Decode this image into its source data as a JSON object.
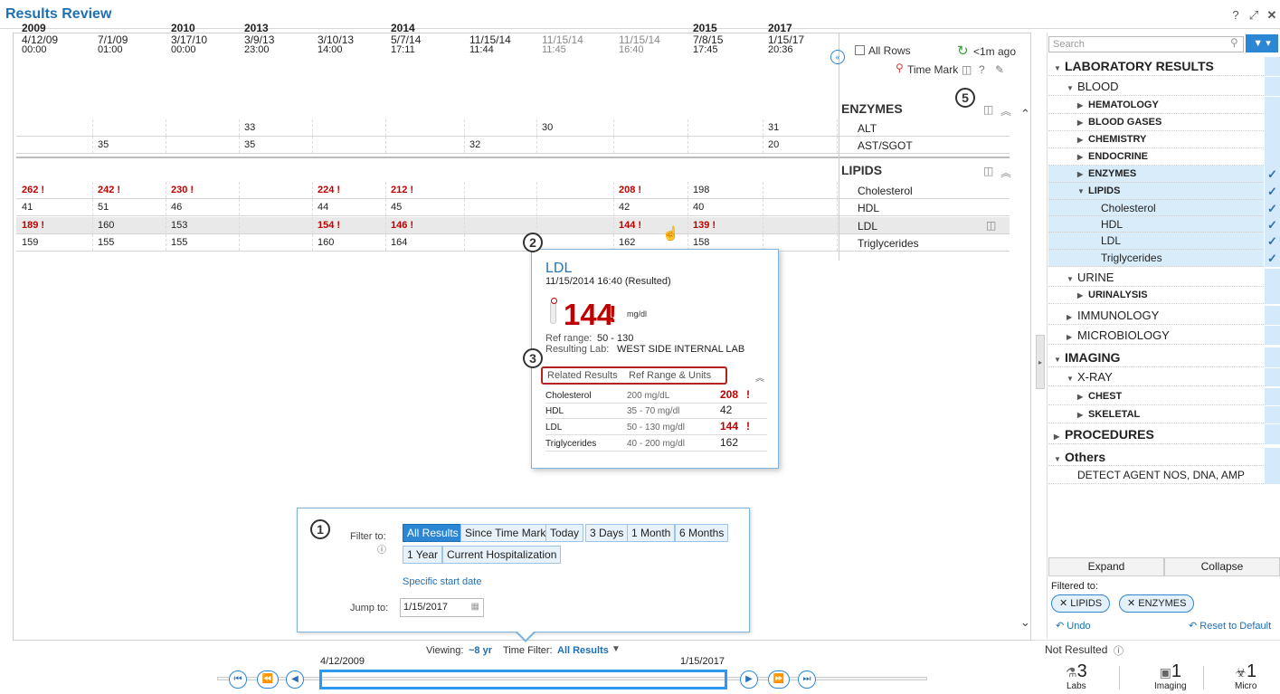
{
  "window": {
    "title": "Results Review"
  },
  "grid": {
    "columns": [
      {
        "year": "2009",
        "date": "4/12/09",
        "time": "00:00",
        "grey": false
      },
      {
        "year": "",
        "date": "7/1/09",
        "time": "01:00",
        "grey": false
      },
      {
        "year": "2010",
        "date": "3/17/10",
        "time": "00:00",
        "grey": false
      },
      {
        "year": "2013",
        "date": "3/9/13",
        "time": "23:00",
        "grey": false
      },
      {
        "year": "",
        "date": "3/10/13",
        "time": "14:00",
        "grey": false
      },
      {
        "year": "2014",
        "date": "5/7/14",
        "time": "17:11",
        "grey": false
      },
      {
        "year": "",
        "date": "11/15/14",
        "time": "11:44",
        "grey": false
      },
      {
        "year": "",
        "date": "11/15/14",
        "time": "11:45",
        "grey": true
      },
      {
        "year": "",
        "date": "11/15/14",
        "time": "16:40",
        "grey": true
      },
      {
        "year": "2015",
        "date": "7/8/15",
        "time": "17:45",
        "grey": false
      },
      {
        "year": "2017",
        "date": "1/15/17",
        "time": "20:36",
        "grey": false
      }
    ],
    "header_controls": {
      "all_rows": "All Rows",
      "refresh": "<1m ago",
      "time_mark": "Time Mark"
    },
    "sections": [
      {
        "name": "ENZYMES",
        "rows": [
          {
            "label": "ALT",
            "values": [
              "",
              "",
              "",
              "33",
              "",
              "",
              "",
              "30",
              "",
              "",
              "31"
            ],
            "abn": []
          },
          {
            "label": "AST/SGOT",
            "values": [
              "",
              "35",
              "",
              "35",
              "",
              "",
              "32",
              "",
              "",
              "",
              "20"
            ],
            "abn": []
          }
        ]
      },
      {
        "name": "LIPIDS",
        "rows": [
          {
            "label": "Cholesterol",
            "values": [
              "262",
              "242",
              "230",
              "",
              "224",
              "212",
              "",
              "",
              "208",
              "198",
              ""
            ],
            "abn": [
              0,
              1,
              2,
              4,
              5,
              8
            ]
          },
          {
            "label": "HDL",
            "values": [
              "41",
              "51",
              "46",
              "",
              "44",
              "45",
              "",
              "",
              "42",
              "40",
              ""
            ],
            "abn": []
          },
          {
            "label": "LDL",
            "values": [
              "189",
              "160",
              "153",
              "",
              "154",
              "146",
              "",
              "",
              "144",
              "139",
              ""
            ],
            "abn": [
              0,
              4,
              5,
              8,
              9
            ]
          },
          {
            "label": "Triglycerides",
            "values": [
              "159",
              "155",
              "155",
              "",
              "160",
              "164",
              "",
              "",
              "162",
              "158",
              ""
            ],
            "abn": []
          }
        ]
      }
    ]
  },
  "popup": {
    "title": "LDL",
    "subtitle": "11/15/2014 16:40 (Resulted)",
    "value": "144",
    "unit": "mg/dl",
    "ref_range_label": "Ref range:",
    "ref_range": "50 - 130",
    "lab_label": "Resulting Lab:",
    "lab": "WEST SIDE INTERNAL LAB",
    "tabs": [
      "Related Results",
      "Ref Range & Units"
    ],
    "related": [
      {
        "name": "Cholesterol",
        "range": "200 mg/dL",
        "value": "208",
        "abn": true
      },
      {
        "name": "HDL",
        "range": "35 - 70 mg/dl",
        "value": "42",
        "abn": false
      },
      {
        "name": "LDL",
        "range": "50 - 130 mg/dl",
        "value": "144",
        "abn": true
      },
      {
        "name": "Triglycerides",
        "range": "40 - 200 mg/dl",
        "value": "162",
        "abn": false
      }
    ]
  },
  "filter_panel": {
    "filter_label": "Filter to:",
    "buttons": [
      "All Results",
      "Since Time Mark",
      "Today",
      "3 Days",
      "1 Month",
      "6 Months",
      "1 Year",
      "Current Hospitalization"
    ],
    "specific_start": "Specific start date",
    "jump_label": "Jump to:",
    "jump_value": "1/15/2017"
  },
  "timeline": {
    "viewing_label": "Viewing:",
    "viewing_value": "~8 yr",
    "filter_label": "Time Filter:",
    "filter_value": "All Results",
    "start": "4/12/2009",
    "end": "1/15/2017"
  },
  "sidebar": {
    "search_placeholder": "Search",
    "tree": [
      {
        "label": "LABORATORY RESULTS",
        "indent": 0,
        "arrow": "down",
        "bold": true,
        "sel": false,
        "check": false,
        "size": 14
      },
      {
        "label": "BLOOD",
        "indent": 1,
        "arrow": "down",
        "bold": false,
        "sel": false,
        "check": false,
        "size": 13
      },
      {
        "label": "HEMATOLOGY",
        "indent": 2,
        "arrow": "right",
        "bold": true,
        "sel": false,
        "check": false,
        "size": 11
      },
      {
        "label": "BLOOD GASES",
        "indent": 2,
        "arrow": "right",
        "bold": true,
        "sel": false,
        "check": false,
        "size": 11
      },
      {
        "label": "CHEMISTRY",
        "indent": 2,
        "arrow": "right",
        "bold": true,
        "sel": false,
        "check": false,
        "size": 11
      },
      {
        "label": "ENDOCRINE",
        "indent": 2,
        "arrow": "right",
        "bold": true,
        "sel": false,
        "check": false,
        "size": 11
      },
      {
        "label": "ENZYMES",
        "indent": 2,
        "arrow": "right",
        "bold": true,
        "sel": true,
        "check": true,
        "size": 11
      },
      {
        "label": "LIPIDS",
        "indent": 2,
        "arrow": "down",
        "bold": true,
        "sel": true,
        "check": true,
        "size": 11
      },
      {
        "label": "Cholesterol",
        "indent": 3,
        "arrow": "",
        "bold": false,
        "sel": true,
        "check": true,
        "size": 12
      },
      {
        "label": "HDL",
        "indent": 3,
        "arrow": "",
        "bold": false,
        "sel": true,
        "check": true,
        "size": 12
      },
      {
        "label": "LDL",
        "indent": 3,
        "arrow": "",
        "bold": false,
        "sel": true,
        "check": true,
        "size": 12
      },
      {
        "label": "Triglycerides",
        "indent": 3,
        "arrow": "",
        "bold": false,
        "sel": true,
        "check": true,
        "size": 12
      },
      {
        "label": "URINE",
        "indent": 1,
        "arrow": "down",
        "bold": false,
        "sel": false,
        "check": false,
        "size": 13
      },
      {
        "label": "URINALYSIS",
        "indent": 2,
        "arrow": "right",
        "bold": true,
        "sel": false,
        "check": false,
        "size": 11
      },
      {
        "label": "IMMUNOLOGY",
        "indent": 1,
        "arrow": "right",
        "bold": false,
        "sel": false,
        "check": false,
        "size": 13
      },
      {
        "label": "MICROBIOLOGY",
        "indent": 1,
        "arrow": "right",
        "bold": false,
        "sel": false,
        "check": false,
        "size": 13
      },
      {
        "label": "IMAGING",
        "indent": 0,
        "arrow": "down",
        "bold": true,
        "sel": false,
        "check": false,
        "size": 14
      },
      {
        "label": "X-RAY",
        "indent": 1,
        "arrow": "down",
        "bold": false,
        "sel": false,
        "check": false,
        "size": 13
      },
      {
        "label": "CHEST",
        "indent": 2,
        "arrow": "right",
        "bold": true,
        "sel": false,
        "check": false,
        "size": 11
      },
      {
        "label": "SKELETAL",
        "indent": 2,
        "arrow": "right",
        "bold": true,
        "sel": false,
        "check": false,
        "size": 11
      },
      {
        "label": "PROCEDURES",
        "indent": 0,
        "arrow": "right",
        "bold": true,
        "sel": false,
        "check": false,
        "size": 14
      },
      {
        "label": "Others",
        "indent": 0,
        "arrow": "down",
        "bold": true,
        "sel": false,
        "check": false,
        "size": 14
      },
      {
        "label": "DETECT AGENT NOS, DNA, AMP",
        "indent": 1,
        "arrow": "",
        "bold": false,
        "sel": false,
        "check": false,
        "size": 12
      }
    ],
    "expand": "Expand",
    "collapse": "Collapse",
    "filtered_to": "Filtered to:",
    "pills": [
      "LIPIDS",
      "ENZYMES"
    ],
    "undo": "Undo",
    "reset": "Reset to Default"
  },
  "not_resulted": {
    "label": "Not Resulted",
    "items": [
      {
        "count": "3",
        "label": "Labs",
        "icon": "flask-icon"
      },
      {
        "count": "1",
        "label": "Imaging",
        "icon": "xray-icon"
      },
      {
        "count": "1",
        "label": "Micro",
        "icon": "biohazard-icon"
      }
    ]
  },
  "callouts": [
    "1",
    "2",
    "3",
    "5"
  ],
  "colors": {
    "accent": "#2b86d4",
    "abnormal": "#c00000",
    "title": "#1f6fb2",
    "selection": "#d9ecfa"
  }
}
